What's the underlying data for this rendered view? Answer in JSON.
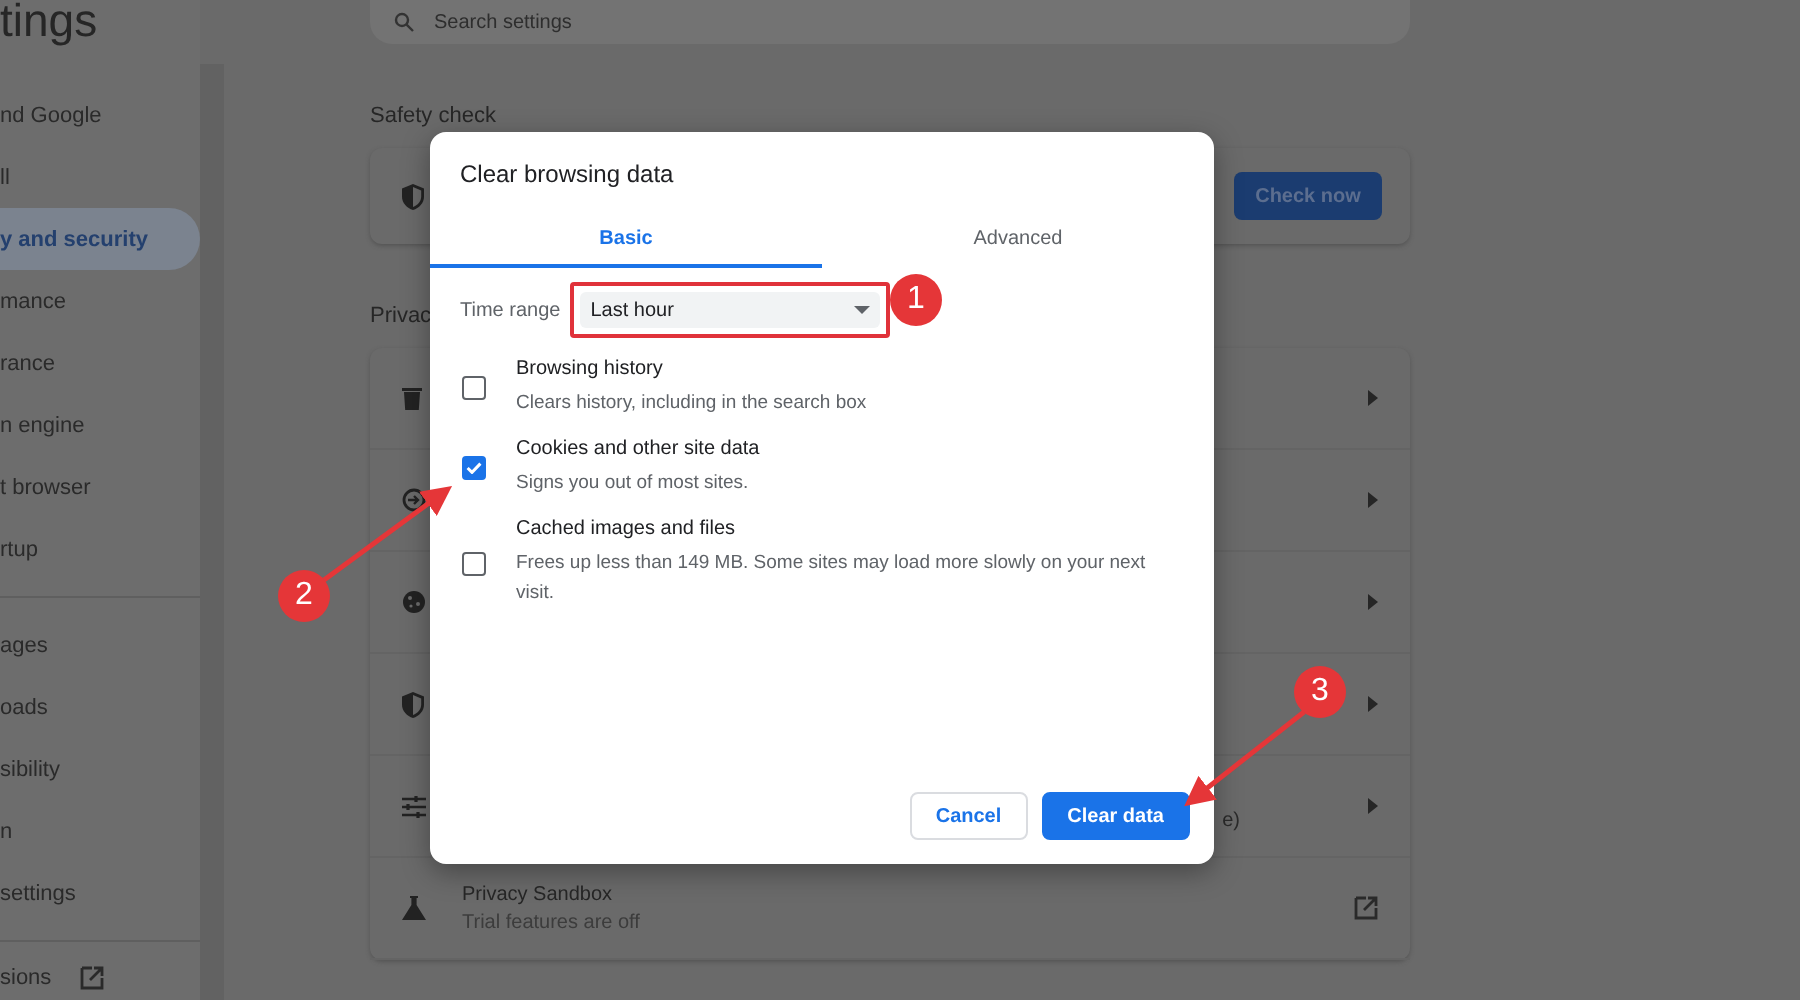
{
  "sidebar": {
    "title": "tings",
    "sections": [
      {
        "items": [
          {
            "label": "nd Google",
            "selected": false
          },
          {
            "label": "ll",
            "selected": false
          },
          {
            "label": "y and security",
            "selected": true
          },
          {
            "label": "mance",
            "selected": false
          },
          {
            "label": "rance",
            "selected": false
          },
          {
            "label": "n engine",
            "selected": false
          },
          {
            "label": "t browser",
            "selected": false
          },
          {
            "label": "rtup",
            "selected": false
          }
        ]
      },
      {
        "items": [
          {
            "label": "ages",
            "selected": false
          },
          {
            "label": "oads",
            "selected": false
          },
          {
            "label": "sibility",
            "selected": false
          },
          {
            "label": "n",
            "selected": false
          },
          {
            "label": "settings",
            "selected": false
          }
        ]
      }
    ],
    "extensions_link": "sions"
  },
  "search": {
    "placeholder": "Search settings"
  },
  "safety_check": {
    "heading": "Safety check",
    "button": "Check now"
  },
  "privacy": {
    "heading": "Privac",
    "rows": [
      {
        "kind": "trash",
        "external": false
      },
      {
        "kind": "cookie-outline",
        "external": false
      },
      {
        "kind": "cookie",
        "external": false
      },
      {
        "kind": "shield",
        "external": false
      },
      {
        "kind": "sliders",
        "fragment": "e)",
        "external": false
      },
      {
        "kind": "flask",
        "title": "Privacy Sandbox",
        "subtitle": "Trial features are off",
        "external": true
      }
    ]
  },
  "dialog": {
    "title": "Clear browsing data",
    "tabs": [
      {
        "label": "Basic",
        "selected": true
      },
      {
        "label": "Advanced",
        "selected": false
      }
    ],
    "time_range": {
      "label": "Time range",
      "value": "Last hour"
    },
    "options": [
      {
        "title": "Browsing history",
        "description": "Clears history, including in the search box",
        "checked": false
      },
      {
        "title": "Cookies and other site data",
        "description": "Signs you out of most sites.",
        "checked": true
      },
      {
        "title": "Cached images and files",
        "description": "Frees up less than 149 MB. Some sites may load more slowly on your next visit.",
        "checked": false
      }
    ],
    "buttons": [
      {
        "label": "Cancel",
        "kind": "secondary"
      },
      {
        "label": "Clear data",
        "kind": "primary"
      }
    ]
  },
  "annotations": [
    {
      "label": "1"
    },
    {
      "label": "2"
    },
    {
      "label": "3"
    }
  ]
}
